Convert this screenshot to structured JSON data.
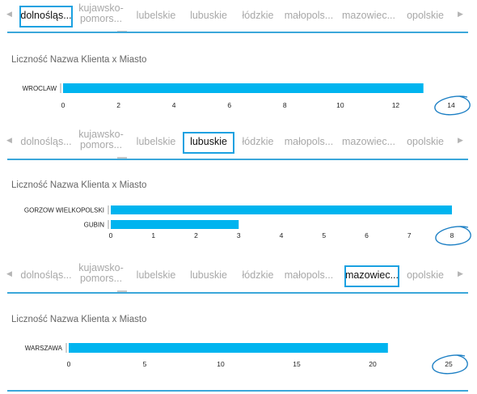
{
  "tab_labels": [
    "dolnośląs...",
    "kujawsko-pomors...",
    "lubelskie",
    "lubuskie",
    "łódzkie",
    "małopols...",
    "mazowiec...",
    "opolskie"
  ],
  "nav": {
    "prev_icon": "triangle-left-icon",
    "next_icon": "triangle-right-icon"
  },
  "colors": {
    "bar": "#00b4ef",
    "accent": "#1aa1e1",
    "annotation": "#1c7fc4"
  },
  "panels": [
    {
      "title": "Liczność Nazwa Klienta x Miasto",
      "selected_tab": "dolnośląs...",
      "chart_data": {
        "type": "bar",
        "orientation": "horizontal",
        "categories": [
          "WROCLAW"
        ],
        "values": [
          13
        ],
        "xlim": [
          0,
          14
        ],
        "xticks": [
          0,
          2,
          4,
          6,
          8,
          10,
          12,
          14
        ],
        "annotation": "14 circled"
      }
    },
    {
      "title": "Liczność Nazwa Klienta x Miasto",
      "selected_tab": "lubuskie",
      "chart_data": {
        "type": "bar",
        "orientation": "horizontal",
        "categories": [
          "GORZOW WIELKOPOLSKI",
          "GUBIN"
        ],
        "values": [
          8,
          3
        ],
        "xlim": [
          0,
          8
        ],
        "xticks": [
          0,
          1,
          2,
          3,
          4,
          5,
          6,
          7,
          8
        ],
        "annotation": "8 circled"
      }
    },
    {
      "title": "Liczność Nazwa Klienta x Miasto",
      "selected_tab": "mazowiec...",
      "chart_data": {
        "type": "bar",
        "orientation": "horizontal",
        "categories": [
          "WARSZAWA"
        ],
        "values": [
          21
        ],
        "xlim": [
          0,
          25
        ],
        "xticks": [
          0,
          5,
          10,
          15,
          20,
          25
        ],
        "annotation": "25 circled"
      }
    }
  ]
}
